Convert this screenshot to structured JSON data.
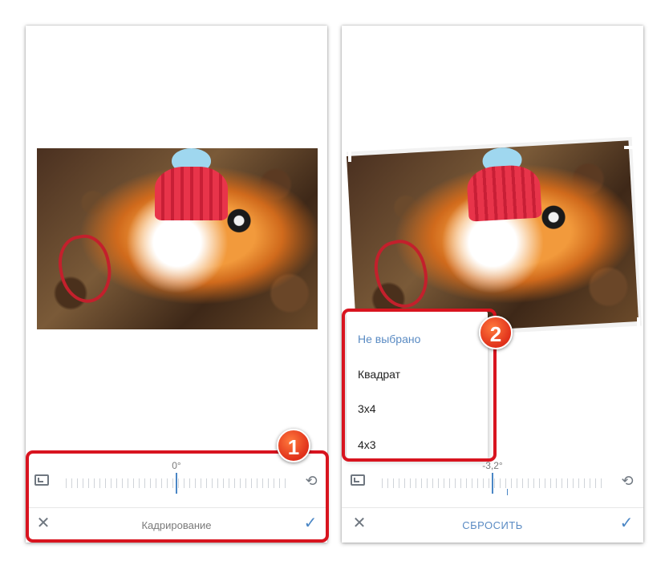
{
  "left_screen": {
    "angle": "0°",
    "title": "Кадрирование",
    "icons": {
      "aspect": "aspect-ratio-icon",
      "rotate": "rotate-icon",
      "close": "close-icon",
      "confirm": "check-icon"
    }
  },
  "right_screen": {
    "angle": "-3,2°",
    "reset_label": "СБРОСИТЬ",
    "aspect_menu": {
      "selected": "Не выбрано",
      "items": [
        "Не выбрано",
        "Квадрат",
        "3x4",
        "4x3"
      ]
    }
  },
  "badges": [
    "1",
    "2"
  ],
  "colors": {
    "accent": "#4a86c5",
    "highlight": "#d8141f",
    "badge": "#e0301a"
  }
}
